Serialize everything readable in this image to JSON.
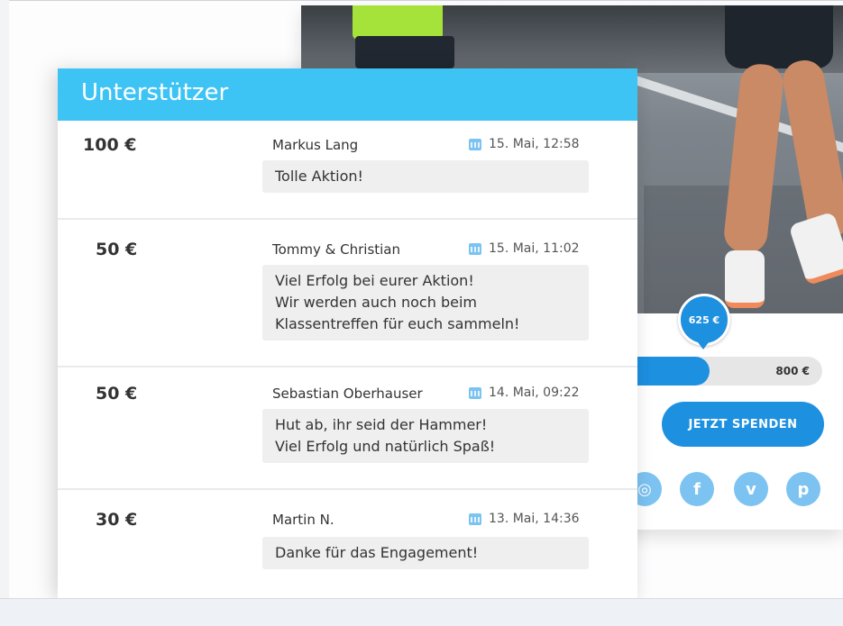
{
  "supporters": {
    "title": "Unterstützer",
    "entries": [
      {
        "amount": "100 €",
        "name": "Markus Lang",
        "date": "15. Mai, 12:58",
        "message_lines": [
          "Tolle Aktion!"
        ]
      },
      {
        "amount": "50 €",
        "name": "Tommy & Christian",
        "date": "15. Mai, 11:02",
        "message_lines": [
          "Viel Erfolg bei eurer Aktion!",
          "Wir werden auch noch beim",
          "Klassentreffen für euch sammeln!"
        ]
      },
      {
        "amount": "50 €",
        "name": "Sebastian Oberhauser",
        "date": "14. Mai, 09:22",
        "message_lines": [
          "Hut ab, ihr seid der Hammer!",
          "Viel Erfolg und natürlich Spaß!"
        ]
      },
      {
        "amount": "30 €",
        "name": "Martin N.",
        "date": "13. Mai, 14:36",
        "message_lines": [
          "Danke für das Engagement!"
        ]
      }
    ]
  },
  "campaign": {
    "current_amount_label": "625 €",
    "goal_label": "800 €",
    "progress_fraction": 0.78,
    "donate_button": "JETZT SPENDEN",
    "social_icons": [
      "instagram-icon",
      "facebook-icon",
      "vimeo-icon",
      "pinterest-icon"
    ],
    "social_glyphs": [
      "◎",
      "f",
      "v",
      "p"
    ]
  },
  "colors": {
    "header_blue": "#3ec4f4",
    "accent_blue": "#1e90e0",
    "social_blue": "#7cc3f2",
    "message_bg": "#efefef"
  }
}
